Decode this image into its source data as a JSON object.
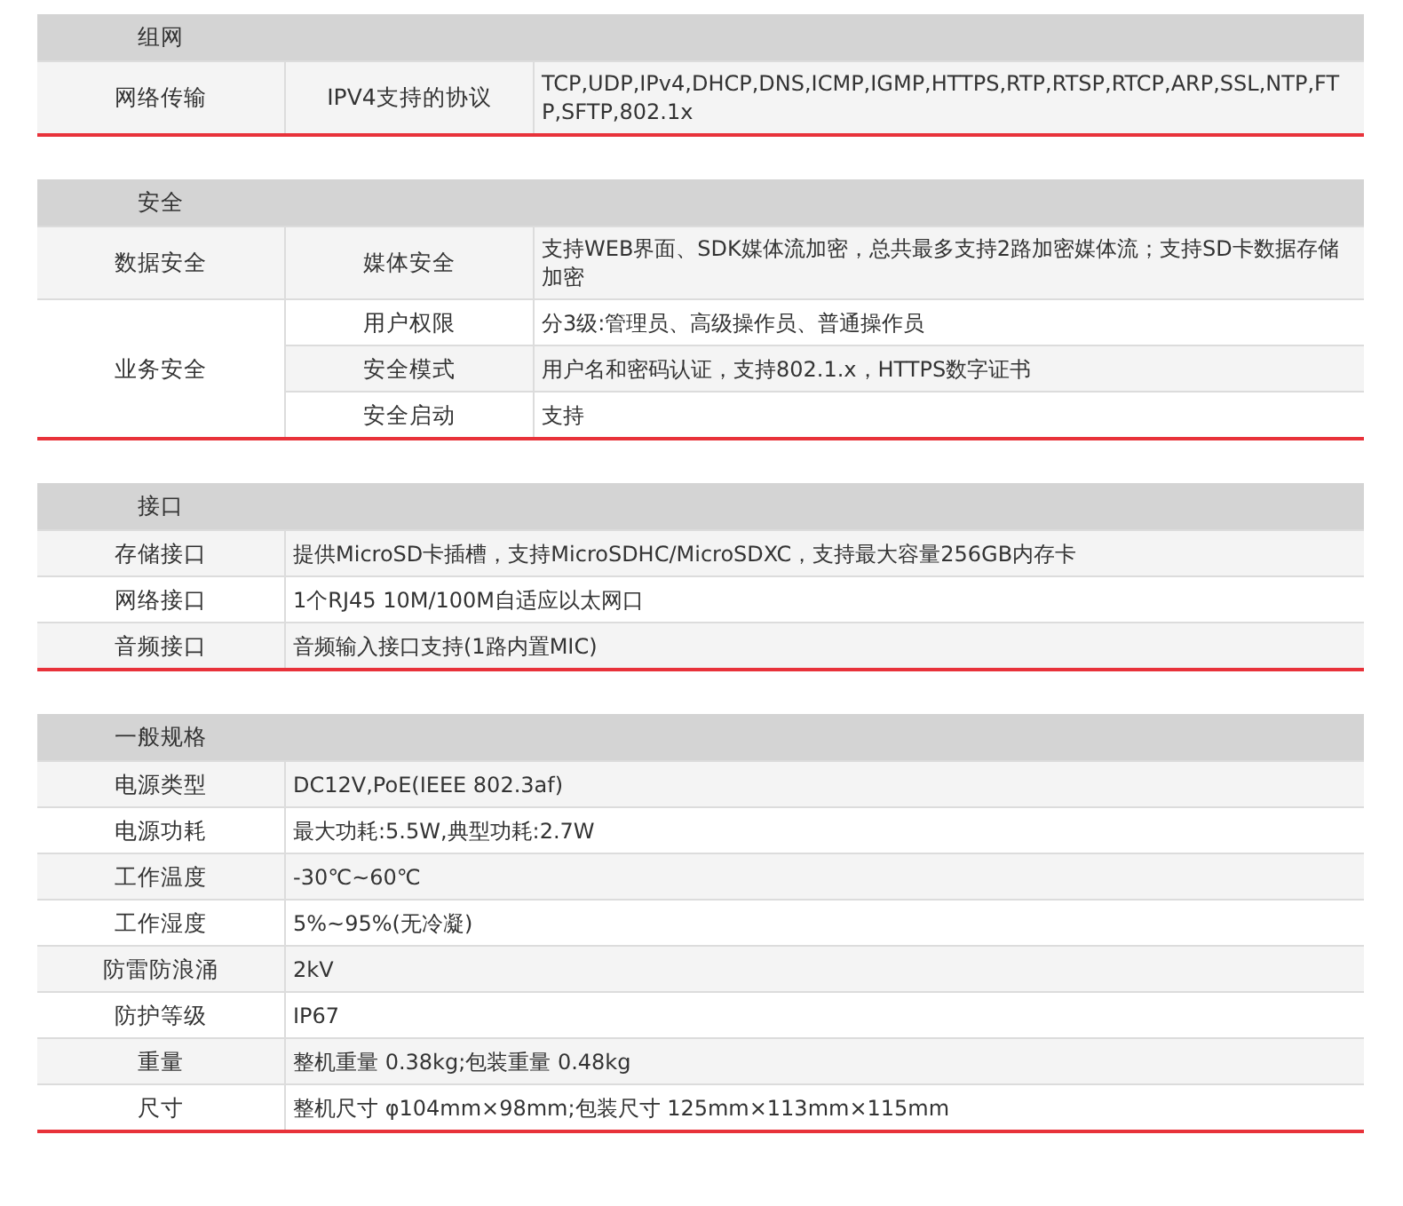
{
  "sections": [
    {
      "title": "组网",
      "kind": "grouped",
      "groups": [
        {
          "label": "网络传输",
          "items": [
            {
              "label": "IPV4支持的协议",
              "value": "TCP,UDP,IPv4,DHCP,DNS,ICMP,IGMP,HTTPS,RTP,RTSP,RTCP,ARP,SSL,NTP,FTP,SFTP,802.1x"
            }
          ]
        }
      ]
    },
    {
      "title": "安全",
      "kind": "grouped",
      "groups": [
        {
          "label": "数据安全",
          "items": [
            {
              "label": "媒体安全",
              "value": "支持WEB界面、SDK媒体流加密，总共最多支持2路加密媒体流；支持SD卡数据存储加密"
            }
          ]
        },
        {
          "label": "业务安全",
          "items": [
            {
              "label": "用户权限",
              "value": "分3级:管理员、高级操作员、普通操作员"
            },
            {
              "label": "安全模式",
              "value": "用户名和密码认证，支持802.1.x，HTTPS数字证书"
            },
            {
              "label": "安全启动",
              "value": "支持"
            }
          ]
        }
      ]
    },
    {
      "title": "接口",
      "kind": "simple",
      "rows": [
        {
          "label": "存储接口",
          "value": "提供MicroSD卡插槽，支持MicroSDHC/MicroSDXC，支持最大容量256GB内存卡"
        },
        {
          "label": "网络接口",
          "value": "1个RJ45 10M/100M自适应以太网口"
        },
        {
          "label": "音频接口",
          "value": "音频输入接口支持(1路内置MIC)"
        }
      ]
    },
    {
      "title": "一般规格",
      "kind": "simple",
      "rows": [
        {
          "label": "电源类型",
          "value": "DC12V,PoE(IEEE 802.3af)"
        },
        {
          "label": "电源功耗",
          "value": "最大功耗:5.5W,典型功耗:2.7W"
        },
        {
          "label": "工作温度",
          "value": "-30℃~60℃"
        },
        {
          "label": "工作湿度",
          "value": "5%~95%(无冷凝)"
        },
        {
          "label": "防雷防浪涌",
          "value": "2kV"
        },
        {
          "label": "防护等级",
          "value": "IP67"
        },
        {
          "label": "重量",
          "value": "整机重量 0.38kg;包装重量 0.48kg"
        },
        {
          "label": "尺寸",
          "value": "整机尺寸 φ104mm×98mm;包装尺寸 125mm×113mm×115mm"
        }
      ]
    }
  ]
}
